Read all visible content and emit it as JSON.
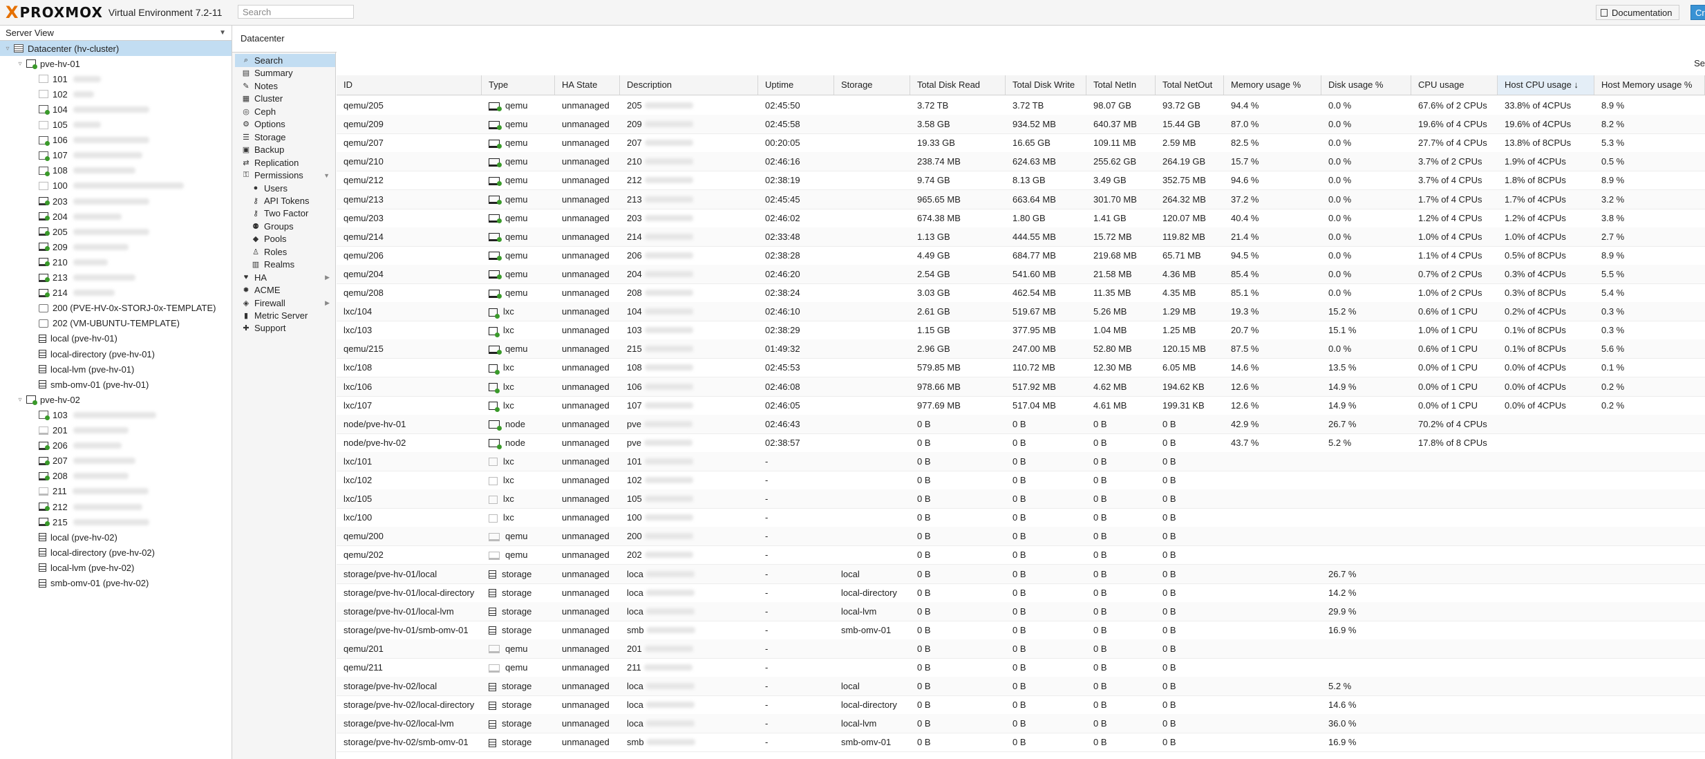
{
  "header": {
    "brand": "PROXMOX",
    "version": "Virtual Environment 7.2-11",
    "search_placeholder": "Search",
    "documentation": "Documentation",
    "create": "Cr"
  },
  "tree": {
    "view": "Server View",
    "items": [
      {
        "label": "Datacenter (hv-cluster)",
        "kind": "dc",
        "indent": 0,
        "selected": true
      },
      {
        "label": "pve-hv-01",
        "kind": "node",
        "indent": 1
      },
      {
        "label": "101",
        "kind": "ct-off",
        "indent": 2,
        "blur": 40
      },
      {
        "label": "102",
        "kind": "ct-off",
        "indent": 2,
        "blur": 30
      },
      {
        "label": "104",
        "kind": "ct-run",
        "indent": 2,
        "blur": 110
      },
      {
        "label": "105",
        "kind": "ct-off",
        "indent": 2,
        "blur": 40
      },
      {
        "label": "106",
        "kind": "ct-run",
        "indent": 2,
        "blur": 110
      },
      {
        "label": "107",
        "kind": "ct-run",
        "indent": 2,
        "blur": 100
      },
      {
        "label": "108",
        "kind": "ct-run",
        "indent": 2,
        "blur": 90
      },
      {
        "label": "100",
        "kind": "ct-off",
        "indent": 2,
        "blur": 160
      },
      {
        "label": "203",
        "kind": "vm-run",
        "indent": 2,
        "blur": 110
      },
      {
        "label": "204",
        "kind": "vm-run",
        "indent": 2,
        "blur": 70
      },
      {
        "label": "205",
        "kind": "vm-run",
        "indent": 2,
        "blur": 110
      },
      {
        "label": "209",
        "kind": "vm-run",
        "indent": 2,
        "blur": 80
      },
      {
        "label": "210",
        "kind": "vm-run",
        "indent": 2,
        "blur": 50
      },
      {
        "label": "213",
        "kind": "vm-run",
        "indent": 2,
        "blur": 90
      },
      {
        "label": "214",
        "kind": "vm-run",
        "indent": 2,
        "blur": 60
      },
      {
        "label": "200 (PVE-HV-0x-STORJ-0x-TEMPLATE)",
        "kind": "tpl",
        "indent": 2
      },
      {
        "label": "202 (VM-UBUNTU-TEMPLATE)",
        "kind": "tpl",
        "indent": 2
      },
      {
        "label": "local (pve-hv-01)",
        "kind": "sto",
        "indent": 2
      },
      {
        "label": "local-directory (pve-hv-01)",
        "kind": "sto",
        "indent": 2
      },
      {
        "label": "local-lvm (pve-hv-01)",
        "kind": "sto",
        "indent": 2
      },
      {
        "label": "smb-omv-01 (pve-hv-01)",
        "kind": "sto",
        "indent": 2
      },
      {
        "label": "pve-hv-02",
        "kind": "node",
        "indent": 1
      },
      {
        "label": "103",
        "kind": "ct-run",
        "indent": 2,
        "blur": 120
      },
      {
        "label": "201",
        "kind": "vm-off",
        "indent": 2,
        "blur": 80
      },
      {
        "label": "206",
        "kind": "vm-run",
        "indent": 2,
        "blur": 70
      },
      {
        "label": "207",
        "kind": "vm-run",
        "indent": 2,
        "blur": 90
      },
      {
        "label": "208",
        "kind": "vm-run",
        "indent": 2,
        "blur": 80
      },
      {
        "label": "211",
        "kind": "vm-off",
        "indent": 2,
        "blur": 110
      },
      {
        "label": "212",
        "kind": "vm-run",
        "indent": 2,
        "blur": 100
      },
      {
        "label": "215",
        "kind": "vm-run",
        "indent": 2,
        "blur": 110
      },
      {
        "label": "local (pve-hv-02)",
        "kind": "sto",
        "indent": 2
      },
      {
        "label": "local-directory (pve-hv-02)",
        "kind": "sto",
        "indent": 2
      },
      {
        "label": "local-lvm (pve-hv-02)",
        "kind": "sto",
        "indent": 2
      },
      {
        "label": "smb-omv-01 (pve-hv-02)",
        "kind": "sto",
        "indent": 2
      }
    ]
  },
  "breadcrumb": "Datacenter",
  "nav": [
    {
      "label": "Search",
      "icon": "search-icon",
      "selected": true
    },
    {
      "label": "Summary",
      "icon": "book-icon"
    },
    {
      "label": "Notes",
      "icon": "notes-icon"
    },
    {
      "label": "Cluster",
      "icon": "server-icon"
    },
    {
      "label": "Ceph",
      "icon": "ceph-icon"
    },
    {
      "label": "Options",
      "icon": "gear-icon"
    },
    {
      "label": "Storage",
      "icon": "database-icon"
    },
    {
      "label": "Backup",
      "icon": "floppy-icon"
    },
    {
      "label": "Replication",
      "icon": "retweet-icon"
    },
    {
      "label": "Permissions",
      "icon": "unlock-icon",
      "arrow": "down"
    },
    {
      "label": "Users",
      "icon": "user-icon",
      "sub": true
    },
    {
      "label": "API Tokens",
      "icon": "key-icon",
      "sub": true
    },
    {
      "label": "Two Factor",
      "icon": "key-icon",
      "sub": true
    },
    {
      "label": "Groups",
      "icon": "users-icon",
      "sub": true
    },
    {
      "label": "Pools",
      "icon": "tags-icon",
      "sub": true
    },
    {
      "label": "Roles",
      "icon": "male-icon",
      "sub": true
    },
    {
      "label": "Realms",
      "icon": "address-book-icon",
      "sub": true
    },
    {
      "label": "HA",
      "icon": "heartbeat-icon",
      "arrow": "right"
    },
    {
      "label": "ACME",
      "icon": "certificate-icon"
    },
    {
      "label": "Firewall",
      "icon": "shield-icon",
      "arrow": "right"
    },
    {
      "label": "Metric Server",
      "icon": "bar-chart-icon"
    },
    {
      "label": "Support",
      "icon": "support-icon"
    }
  ],
  "grid": {
    "search_label": "Se",
    "columns": [
      "ID",
      "Type",
      "HA State",
      "Description",
      "Uptime",
      "Storage",
      "Total Disk Read",
      "Total Disk Write",
      "Total NetIn",
      "Total NetOut",
      "Memory usage %",
      "Disk usage %",
      "CPU usage",
      "Host CPU usage ↓",
      "Host Memory usage %"
    ],
    "rows": [
      [
        "qemu/205",
        "qemu",
        "unmanaged",
        "205",
        "02:45:50",
        "",
        "3.72 TB",
        "3.72 TB",
        "98.07 GB",
        "93.72 GB",
        "94.4 %",
        "0.0 %",
        "67.6% of 2 CPUs",
        "33.8% of 4CPUs",
        "8.9 %"
      ],
      [
        "qemu/209",
        "qemu",
        "unmanaged",
        "209",
        "02:45:58",
        "",
        "3.58 GB",
        "934.52 MB",
        "640.37 MB",
        "15.44 GB",
        "87.0 %",
        "0.0 %",
        "19.6% of 4 CPUs",
        "19.6% of 4CPUs",
        "8.2 %"
      ],
      [
        "qemu/207",
        "qemu",
        "unmanaged",
        "207",
        "00:20:05",
        "",
        "19.33 GB",
        "16.65 GB",
        "109.11 MB",
        "2.59 MB",
        "82.5 %",
        "0.0 %",
        "27.7% of 4 CPUs",
        "13.8% of 8CPUs",
        "5.3 %"
      ],
      [
        "qemu/210",
        "qemu",
        "unmanaged",
        "210",
        "02:46:16",
        "",
        "238.74 MB",
        "624.63 MB",
        "255.62 GB",
        "264.19 GB",
        "15.7 %",
        "0.0 %",
        "3.7% of 2 CPUs",
        "1.9% of 4CPUs",
        "0.5 %"
      ],
      [
        "qemu/212",
        "qemu",
        "unmanaged",
        "212",
        "02:38:19",
        "",
        "9.74 GB",
        "8.13 GB",
        "3.49 GB",
        "352.75 MB",
        "94.6 %",
        "0.0 %",
        "3.7% of 4 CPUs",
        "1.8% of 8CPUs",
        "8.9 %"
      ],
      [
        "qemu/213",
        "qemu",
        "unmanaged",
        "213",
        "02:45:45",
        "",
        "965.65 MB",
        "663.64 MB",
        "301.70 MB",
        "264.32 MB",
        "37.2 %",
        "0.0 %",
        "1.7% of 4 CPUs",
        "1.7% of 4CPUs",
        "3.2 %"
      ],
      [
        "qemu/203",
        "qemu",
        "unmanaged",
        "203",
        "02:46:02",
        "",
        "674.38 MB",
        "1.80 GB",
        "1.41 GB",
        "120.07 MB",
        "40.4 %",
        "0.0 %",
        "1.2% of 4 CPUs",
        "1.2% of 4CPUs",
        "3.8 %"
      ],
      [
        "qemu/214",
        "qemu",
        "unmanaged",
        "214",
        "02:33:48",
        "",
        "1.13 GB",
        "444.55 MB",
        "15.72 MB",
        "119.82 MB",
        "21.4 %",
        "0.0 %",
        "1.0% of 4 CPUs",
        "1.0% of 4CPUs",
        "2.7 %"
      ],
      [
        "qemu/206",
        "qemu",
        "unmanaged",
        "206",
        "02:38:28",
        "",
        "4.49 GB",
        "684.77 MB",
        "219.68 MB",
        "65.71 MB",
        "94.5 %",
        "0.0 %",
        "1.1% of 4 CPUs",
        "0.5% of 8CPUs",
        "8.9 %"
      ],
      [
        "qemu/204",
        "qemu",
        "unmanaged",
        "204",
        "02:46:20",
        "",
        "2.54 GB",
        "541.60 MB",
        "21.58 MB",
        "4.36 MB",
        "85.4 %",
        "0.0 %",
        "0.7% of 2 CPUs",
        "0.3% of 4CPUs",
        "5.5 %"
      ],
      [
        "qemu/208",
        "qemu",
        "unmanaged",
        "208",
        "02:38:24",
        "",
        "3.03 GB",
        "462.54 MB",
        "11.35 MB",
        "4.35 MB",
        "85.1 %",
        "0.0 %",
        "1.0% of 2 CPUs",
        "0.3% of 8CPUs",
        "5.4 %"
      ],
      [
        "lxc/104",
        "lxc",
        "unmanaged",
        "104",
        "02:46:10",
        "",
        "2.61 GB",
        "519.67 MB",
        "5.26 MB",
        "1.29 MB",
        "19.3 %",
        "15.2 %",
        "0.6% of 1 CPU",
        "0.2% of 4CPUs",
        "0.3 %"
      ],
      [
        "lxc/103",
        "lxc",
        "unmanaged",
        "103",
        "02:38:29",
        "",
        "1.15 GB",
        "377.95 MB",
        "1.04 MB",
        "1.25 MB",
        "20.7 %",
        "15.1 %",
        "1.0% of 1 CPU",
        "0.1% of 8CPUs",
        "0.3 %"
      ],
      [
        "qemu/215",
        "qemu",
        "unmanaged",
        "215",
        "01:49:32",
        "",
        "2.96 GB",
        "247.00 MB",
        "52.80 MB",
        "120.15 MB",
        "87.5 %",
        "0.0 %",
        "0.6% of 1 CPU",
        "0.1% of 8CPUs",
        "5.6 %"
      ],
      [
        "lxc/108",
        "lxc",
        "unmanaged",
        "108",
        "02:45:53",
        "",
        "579.85 MB",
        "110.72 MB",
        "12.30 MB",
        "6.05 MB",
        "14.6 %",
        "13.5 %",
        "0.0% of 1 CPU",
        "0.0% of 4CPUs",
        "0.1 %"
      ],
      [
        "lxc/106",
        "lxc",
        "unmanaged",
        "106",
        "02:46:08",
        "",
        "978.66 MB",
        "517.92 MB",
        "4.62 MB",
        "194.62 KB",
        "12.6 %",
        "14.9 %",
        "0.0% of 1 CPU",
        "0.0% of 4CPUs",
        "0.2 %"
      ],
      [
        "lxc/107",
        "lxc",
        "unmanaged",
        "107",
        "02:46:05",
        "",
        "977.69 MB",
        "517.04 MB",
        "4.61 MB",
        "199.31 KB",
        "12.6 %",
        "14.9 %",
        "0.0% of 1 CPU",
        "0.0% of 4CPUs",
        "0.2 %"
      ],
      [
        "node/pve-hv-01",
        "node",
        "unmanaged",
        "pve",
        "02:46:43",
        "",
        "0 B",
        "0 B",
        "0 B",
        "0 B",
        "42.9 %",
        "26.7 %",
        "70.2% of 4 CPUs",
        "",
        ""
      ],
      [
        "node/pve-hv-02",
        "node",
        "unmanaged",
        "pve",
        "02:38:57",
        "",
        "0 B",
        "0 B",
        "0 B",
        "0 B",
        "43.7 %",
        "5.2 %",
        "17.8% of 8 CPUs",
        "",
        ""
      ],
      [
        "lxc/101",
        "lxc",
        "unmanaged",
        "101",
        "-",
        "",
        "0 B",
        "0 B",
        "0 B",
        "0 B",
        "",
        "",
        "",
        "",
        ""
      ],
      [
        "lxc/102",
        "lxc",
        "unmanaged",
        "102",
        "-",
        "",
        "0 B",
        "0 B",
        "0 B",
        "0 B",
        "",
        "",
        "",
        "",
        ""
      ],
      [
        "lxc/105",
        "lxc",
        "unmanaged",
        "105",
        "-",
        "",
        "0 B",
        "0 B",
        "0 B",
        "0 B",
        "",
        "",
        "",
        "",
        ""
      ],
      [
        "lxc/100",
        "lxc",
        "unmanaged",
        "100",
        "-",
        "",
        "0 B",
        "0 B",
        "0 B",
        "0 B",
        "",
        "",
        "",
        "",
        ""
      ],
      [
        "qemu/200",
        "qemu",
        "unmanaged",
        "200",
        "-",
        "",
        "0 B",
        "0 B",
        "0 B",
        "0 B",
        "",
        "",
        "",
        "",
        ""
      ],
      [
        "qemu/202",
        "qemu",
        "unmanaged",
        "202",
        "-",
        "",
        "0 B",
        "0 B",
        "0 B",
        "0 B",
        "",
        "",
        "",
        "",
        ""
      ],
      [
        "storage/pve-hv-01/local",
        "storage",
        "unmanaged",
        "loca",
        "-",
        "local",
        "0 B",
        "0 B",
        "0 B",
        "0 B",
        "",
        "26.7 %",
        "",
        "",
        ""
      ],
      [
        "storage/pve-hv-01/local-directory",
        "storage",
        "unmanaged",
        "loca",
        "-",
        "local-directory",
        "0 B",
        "0 B",
        "0 B",
        "0 B",
        "",
        "14.2 %",
        "",
        "",
        ""
      ],
      [
        "storage/pve-hv-01/local-lvm",
        "storage",
        "unmanaged",
        "loca",
        "-",
        "local-lvm",
        "0 B",
        "0 B",
        "0 B",
        "0 B",
        "",
        "29.9 %",
        "",
        "",
        ""
      ],
      [
        "storage/pve-hv-01/smb-omv-01",
        "storage",
        "unmanaged",
        "smb",
        "-",
        "smb-omv-01",
        "0 B",
        "0 B",
        "0 B",
        "0 B",
        "",
        "16.9 %",
        "",
        "",
        ""
      ],
      [
        "qemu/201",
        "qemu",
        "unmanaged",
        "201",
        "-",
        "",
        "0 B",
        "0 B",
        "0 B",
        "0 B",
        "",
        "",
        "",
        "",
        ""
      ],
      [
        "qemu/211",
        "qemu",
        "unmanaged",
        "211",
        "-",
        "",
        "0 B",
        "0 B",
        "0 B",
        "0 B",
        "",
        "",
        "",
        "",
        ""
      ],
      [
        "storage/pve-hv-02/local",
        "storage",
        "unmanaged",
        "loca",
        "-",
        "local",
        "0 B",
        "0 B",
        "0 B",
        "0 B",
        "",
        "5.2 %",
        "",
        "",
        ""
      ],
      [
        "storage/pve-hv-02/local-directory",
        "storage",
        "unmanaged",
        "loca",
        "-",
        "local-directory",
        "0 B",
        "0 B",
        "0 B",
        "0 B",
        "",
        "14.6 %",
        "",
        "",
        ""
      ],
      [
        "storage/pve-hv-02/local-lvm",
        "storage",
        "unmanaged",
        "loca",
        "-",
        "local-lvm",
        "0 B",
        "0 B",
        "0 B",
        "0 B",
        "",
        "36.0 %",
        "",
        "",
        ""
      ],
      [
        "storage/pve-hv-02/smb-omv-01",
        "storage",
        "unmanaged",
        "smb",
        "-",
        "smb-omv-01",
        "0 B",
        "0 B",
        "0 B",
        "0 B",
        "",
        "16.9 %",
        "",
        "",
        ""
      ]
    ]
  },
  "colors": {
    "accent": "#3892d4",
    "selected": "#c2ddf2",
    "running": "#3a9a2a",
    "brand_x": "#e57000"
  }
}
